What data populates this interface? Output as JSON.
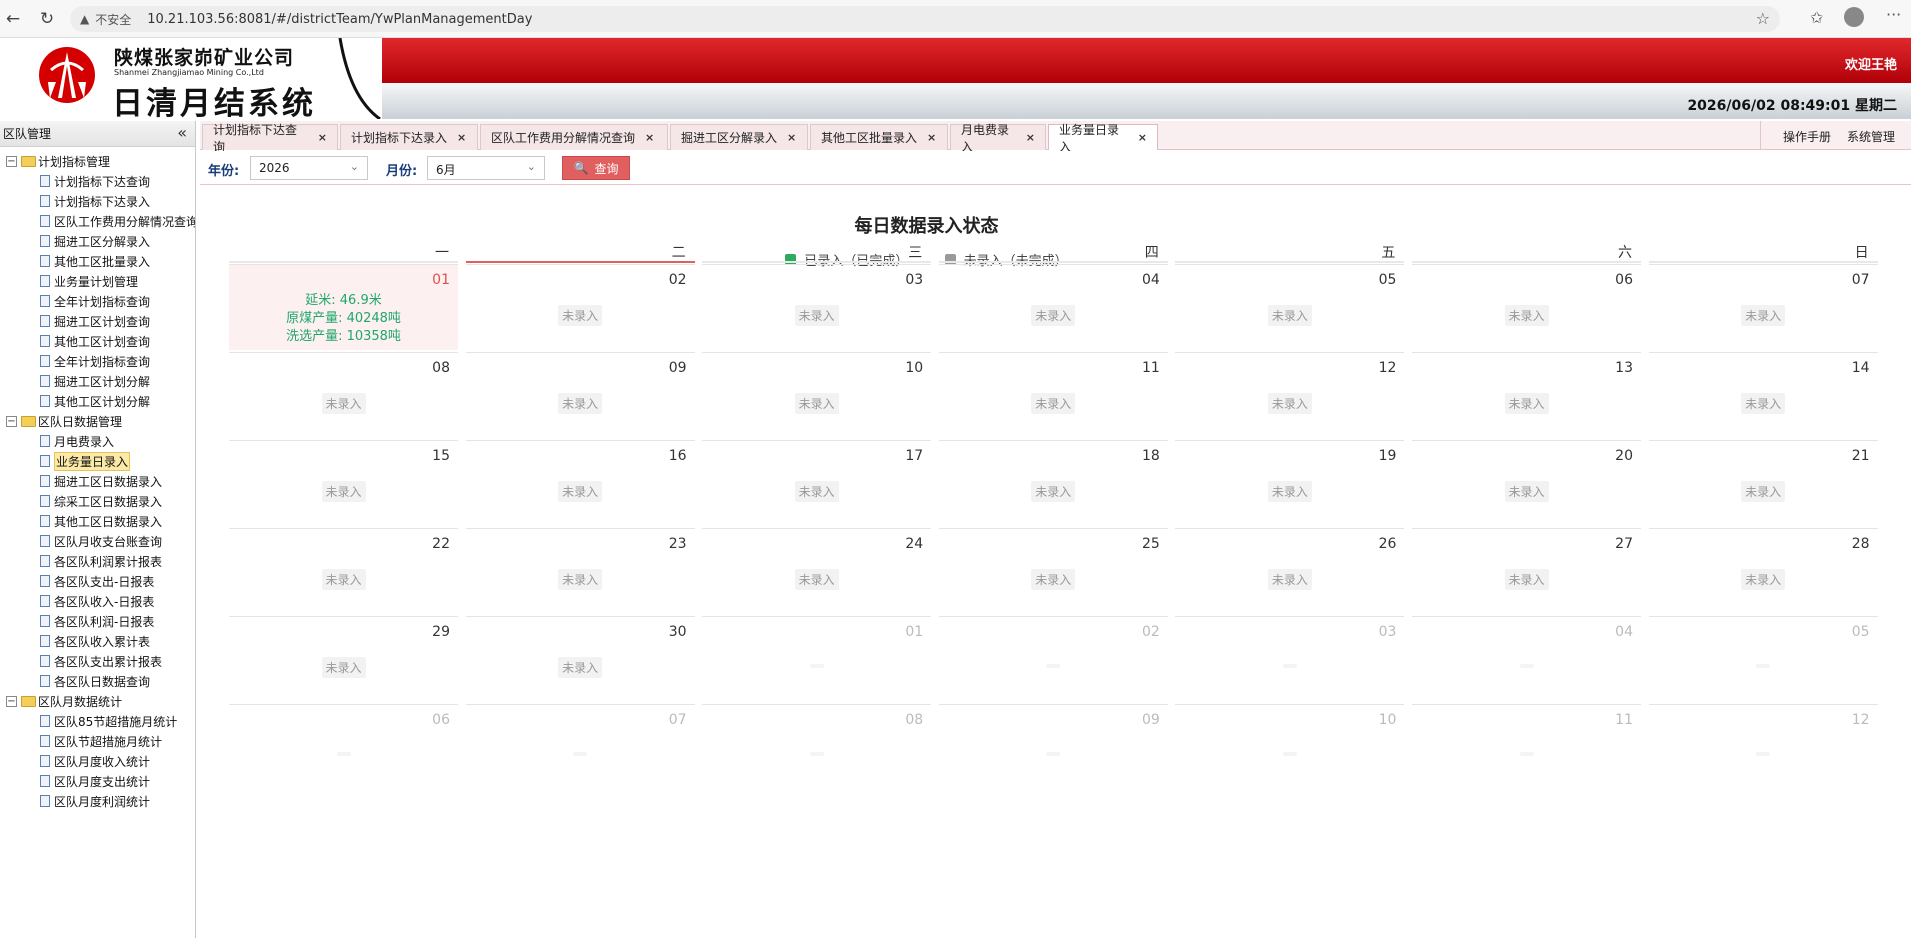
{
  "browser": {
    "insecure_label": "不安全",
    "url": "10.21.103.56:8081/#/districtTeam/YwPlanManagementDay"
  },
  "header": {
    "company_cn": "陕煤张家峁矿业公司",
    "company_en": "Shanmei Zhangjiamao Mining Co.,Ltd",
    "system_name": "日清月结系统",
    "welcome": "欢迎王艳",
    "datetime": "2026/06/02 08:49:01 星期二"
  },
  "sidebar": {
    "title": "区队管理",
    "groups": [
      {
        "label": "计划指标管理",
        "items": [
          "计划指标下达查询",
          "计划指标下达录入",
          "区队工作费用分解情况查询",
          "掘进工区分解录入",
          "其他工区批量录入",
          "业务量计划管理",
          "全年计划指标查询",
          "掘进工区计划查询",
          "其他工区计划查询",
          "全年计划指标查询",
          "掘进工区计划分解",
          "其他工区计划分解"
        ]
      },
      {
        "label": "区队日数据管理",
        "items": [
          "月电费录入",
          "业务量日录入",
          "掘进工区日数据录入",
          "综采工区日数据录入",
          "其他工区日数据录入",
          "区队月收支台账查询",
          "各区队利润累计报表",
          "各区队支出-日报表",
          "各区队收入-日报表",
          "各区队利润-日报表",
          "各区队收入累计表",
          "各区队支出累计报表",
          "各区队日数据查询"
        ]
      },
      {
        "label": "区队月数据统计",
        "items": [
          "区队85节超措施月统计",
          "区队节超措施月统计",
          "区队月度收入统计",
          "区队月度支出统计",
          "区队月度利润统计"
        ]
      }
    ],
    "selected": "业务量日录入"
  },
  "tabs": {
    "items": [
      "计划指标下达查询",
      "计划指标下达录入",
      "区队工作费用分解情况查询",
      "掘进工区分解录入",
      "其他工区批量录入",
      "月电费录入",
      "业务量日录入"
    ],
    "active": "业务量日录入",
    "help": "操作手册",
    "system": "系统管理"
  },
  "filter": {
    "year_label": "年份:",
    "year_value": "2026",
    "month_label": "月份:",
    "month_value": "6月",
    "query_label": "查询"
  },
  "calendar": {
    "title": "每日数据录入状态",
    "legend_done": "已录入（已完成）",
    "legend_todo": "未录入（未完成）",
    "color_done": "#2eaa5f",
    "color_todo": "#999999",
    "weekdays": [
      "一",
      "二",
      "三",
      "四",
      "五",
      "六",
      "日"
    ],
    "pending_label": "未录入",
    "weeks": [
      [
        "01",
        "02",
        "03",
        "04",
        "05",
        "06",
        "07"
      ],
      [
        "08",
        "09",
        "10",
        "11",
        "12",
        "13",
        "14"
      ],
      [
        "15",
        "16",
        "17",
        "18",
        "19",
        "20",
        "21"
      ],
      [
        "22",
        "23",
        "24",
        "25",
        "26",
        "27",
        "28"
      ],
      [
        "29",
        "30",
        "01",
        "02",
        "03",
        "04",
        "05"
      ],
      [
        "06",
        "07",
        "08",
        "09",
        "10",
        "11",
        "12"
      ]
    ],
    "done_day": {
      "date": "01",
      "lines": [
        "延米: 46.9米",
        "原煤产量: 40248吨",
        "洗选产量: 10358吨"
      ]
    }
  }
}
